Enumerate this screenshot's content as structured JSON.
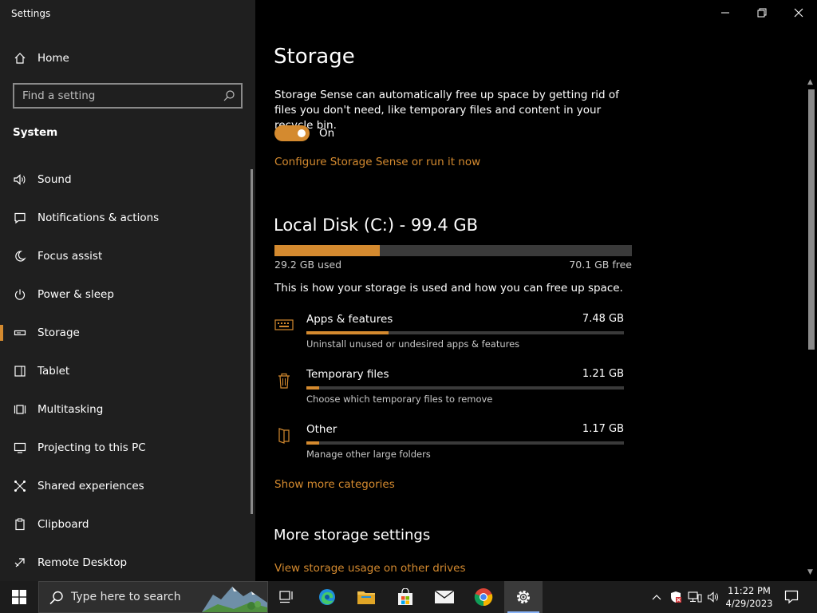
{
  "window": {
    "title": "Settings",
    "controls": [
      "minimize",
      "restore",
      "close"
    ]
  },
  "sidebar": {
    "home_label": "Home",
    "search_placeholder": "Find a setting",
    "section_title": "System",
    "items": [
      {
        "label": "Sound",
        "icon": "speaker-icon"
      },
      {
        "label": "Notifications & actions",
        "icon": "message-icon"
      },
      {
        "label": "Focus assist",
        "icon": "moon-icon"
      },
      {
        "label": "Power & sleep",
        "icon": "power-icon"
      },
      {
        "label": "Storage",
        "icon": "drive-icon",
        "active": true
      },
      {
        "label": "Tablet",
        "icon": "tablet-icon"
      },
      {
        "label": "Multitasking",
        "icon": "multitasking-icon"
      },
      {
        "label": "Projecting to this PC",
        "icon": "projector-icon"
      },
      {
        "label": "Shared experiences",
        "icon": "share-icon"
      },
      {
        "label": "Clipboard",
        "icon": "clipboard-icon"
      },
      {
        "label": "Remote Desktop",
        "icon": "remote-desktop-icon"
      }
    ]
  },
  "main": {
    "title": "Storage",
    "sense_description": "Storage Sense can automatically free up space by getting rid of files you don't need, like temporary files and content in your recycle bin.",
    "toggle_state": "On",
    "configure_link": "Configure Storage Sense or run it now",
    "disk": {
      "title": "Local Disk (C:) - 99.4 GB",
      "used_label": "29.2 GB used",
      "free_label": "70.1 GB free",
      "used_fraction": 0.294
    },
    "usage_description": "This is how your storage is used and how you can free up space.",
    "categories": [
      {
        "name": "Apps & features",
        "size": "7.48 GB",
        "description": "Uninstall unused or undesired apps & features",
        "icon": "apps-keyboard-icon",
        "fraction": 0.26
      },
      {
        "name": "Temporary files",
        "size": "1.21 GB",
        "description": "Choose which temporary files to remove",
        "icon": "trash-icon",
        "fraction": 0.04
      },
      {
        "name": "Other",
        "size": "1.17 GB",
        "description": "Manage other large folders",
        "icon": "folder-icon",
        "fraction": 0.04
      }
    ],
    "show_more_link": "Show more categories",
    "more_settings_title": "More storage settings",
    "view_usage_link": "View storage usage on other drives"
  },
  "taskbar": {
    "search_placeholder": "Type here to search",
    "apps": [
      "task-view-icon",
      "edge-icon",
      "file-explorer-icon",
      "store-icon",
      "mail-icon",
      "chrome-icon",
      "settings-icon"
    ],
    "time": "11:22 PM",
    "date": "4/29/2023"
  },
  "colors": {
    "accent": "#d48a2f",
    "sidebar_bg": "#1f1f1f",
    "main_bg": "#000000",
    "taskbar_bg": "#1c1c1c"
  }
}
